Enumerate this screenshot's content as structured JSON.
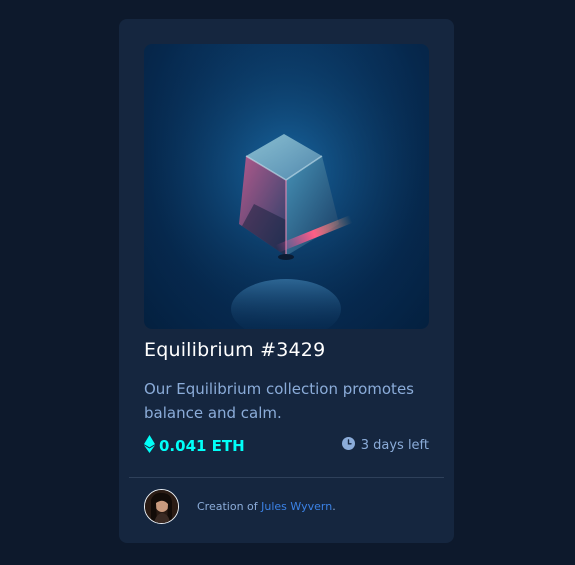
{
  "card": {
    "title": "Equilibrium #3429",
    "description": "Our Equilibrium collection promotes balance and calm.",
    "price": "0.041 ETH",
    "time_left": "3 days left",
    "creation_prefix": "Creation of ",
    "creator_name": "Jules Wyvern",
    "creation_suffix": "."
  },
  "colors": {
    "page_bg": "#0d192c",
    "card_bg": "#15263f",
    "accent_cyan": "#00fff8",
    "soft_blue": "#8bacd9",
    "link_blue": "#3b82e6"
  },
  "icons": {
    "price": "ethereum-icon",
    "time": "clock-icon"
  }
}
